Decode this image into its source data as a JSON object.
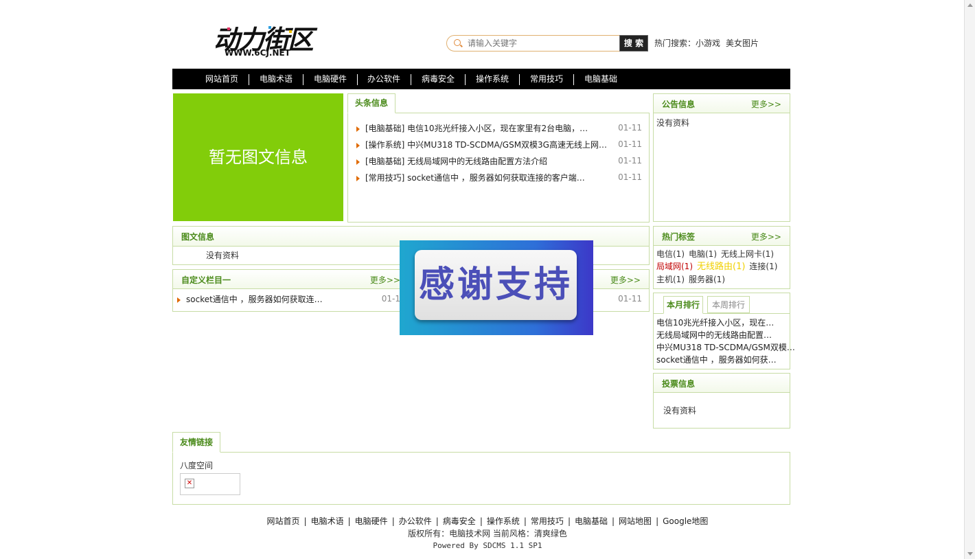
{
  "logo": {
    "main": "动力街区",
    "sub": "WWW.6CJ.NET"
  },
  "search": {
    "placeholder": "请输入关键字",
    "button": "搜 索",
    "hot_label": "热门搜索：",
    "hot_items": [
      "小游戏",
      "美女图片"
    ]
  },
  "nav": [
    "网站首页",
    "电脑术语",
    "电脑硬件",
    "办公软件",
    "病毒安全",
    "操作系统",
    "常用技巧",
    "电脑基础"
  ],
  "banner": {
    "text": "暂无图文信息"
  },
  "headline": {
    "title": "头条信息",
    "items": [
      {
        "text": "[电脑基础] 电信10兆光纤接入小区，现在家里有2台电脑，…",
        "date": "01-11"
      },
      {
        "text": "[操作系统] 中兴MU318 TD-SCDMA/GSM双模3G高速无线上网…",
        "date": "01-11"
      },
      {
        "text": "[电脑基础] 无线局域网中的无线路由配置方法介绍",
        "date": "01-11"
      },
      {
        "text": "[常用技巧] socket通信中 ，服务器如何获取连接的客户端…",
        "date": "01-11"
      }
    ]
  },
  "notice": {
    "title": "公告信息",
    "more": "更多>>",
    "empty": "没有资料"
  },
  "image_info": {
    "title": "图文信息",
    "empty": "没有资料"
  },
  "custom1": {
    "title": "自定义栏目一",
    "more": "更多>>",
    "item": "socket通信中 ，服务器如何获取连…",
    "date": "01-1"
  },
  "custom2": {
    "more": "更多>>",
    "date": "01-11"
  },
  "hot_tags": {
    "title": "热门标签",
    "more": "更多>>",
    "tags": [
      "电信(1)",
      "电脑(1)",
      "无线上网卡(1)",
      "局域网(1)",
      "无线路由(1)",
      "连接(1)",
      "主机(1)",
      "服务器(1)"
    ],
    "colors": {
      "red": "#c00000",
      "yellow": "#f0d000"
    }
  },
  "rank": {
    "tab_month": "本月排行",
    "tab_week": "本周排行",
    "items": [
      "电信10兆光纤接入小区，现在…",
      "无线局域网中的无线路由配置…",
      "中兴MU318 TD-SCDMA/GSM双模…",
      "socket通信中 ，服务器如何获…"
    ]
  },
  "vote": {
    "title": "投票信息",
    "empty": "没有资料"
  },
  "links": {
    "title": "友情链接",
    "item": "八度空间"
  },
  "popup": {
    "text": "感谢支持"
  },
  "footer": {
    "nav": [
      "网站首页",
      "电脑术语",
      "电脑硬件",
      "办公软件",
      "病毒安全",
      "操作系统",
      "常用技巧",
      "电脑基础",
      "网站地图",
      "Google地图"
    ],
    "copyright": "版权所有：电脑技术网  当前风格：清爽绿色",
    "powered": "Powered By SDCMS 1.1 SP1"
  },
  "colors": {
    "accent_green": "#82cd0a",
    "title_green": "#4a8a1a",
    "nav_bg": "#000000",
    "arrow": "#e06a00"
  }
}
